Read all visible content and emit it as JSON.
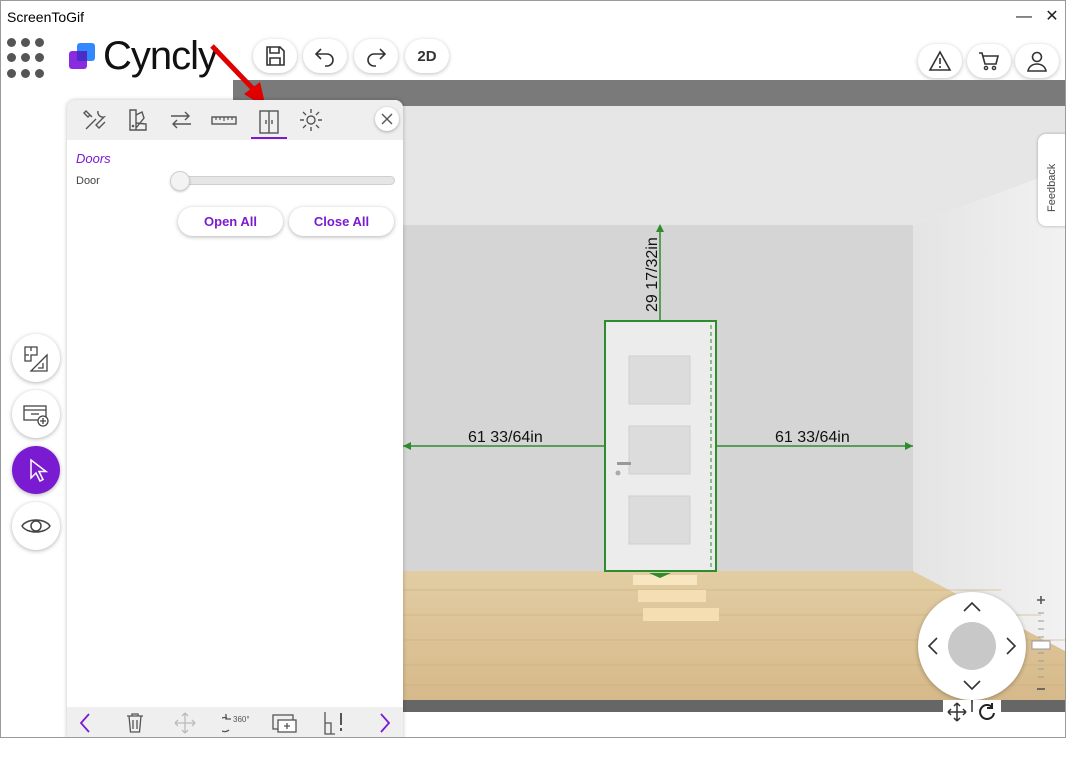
{
  "window": {
    "title": "ScreenToGif",
    "minimize": "—",
    "close": "✕"
  },
  "app": {
    "logo_text": "Cyncly",
    "view_toggle": "2D"
  },
  "header_icons": [
    "apps-grid-icon",
    "save-icon",
    "undo-icon",
    "redo-icon",
    "warning-icon",
    "cart-icon",
    "user-icon"
  ],
  "panel": {
    "tabs": [
      "tools-icon",
      "materials-icon",
      "swap-icon",
      "ruler-icon",
      "door-icon",
      "settings-icon"
    ],
    "active_tab": "door-icon",
    "section_title": "Doors",
    "door_label": "Door",
    "door_open_level": 0,
    "open_all_label": "Open All",
    "close_all_label": "Close All",
    "bottom_icons": [
      "prev-icon",
      "trash-icon",
      "move-icon",
      "rotate-360-icon",
      "add-view-icon",
      "warning-wall-icon",
      "next-icon"
    ],
    "rotate_label": "360°"
  },
  "sidebar": {
    "items": [
      "floorplan-icon",
      "add-cabinet-icon",
      "select-cursor-icon",
      "view-eye-icon"
    ],
    "active": "select-cursor-icon"
  },
  "feedback_label": "Feedback",
  "dimensions": {
    "top": "29 17/32in",
    "left": "61 33/64in",
    "right": "61 33/64in"
  },
  "colors": {
    "accent": "#7a1bd2",
    "dimension": "#2e8b2e",
    "arrow": "#e00000"
  }
}
